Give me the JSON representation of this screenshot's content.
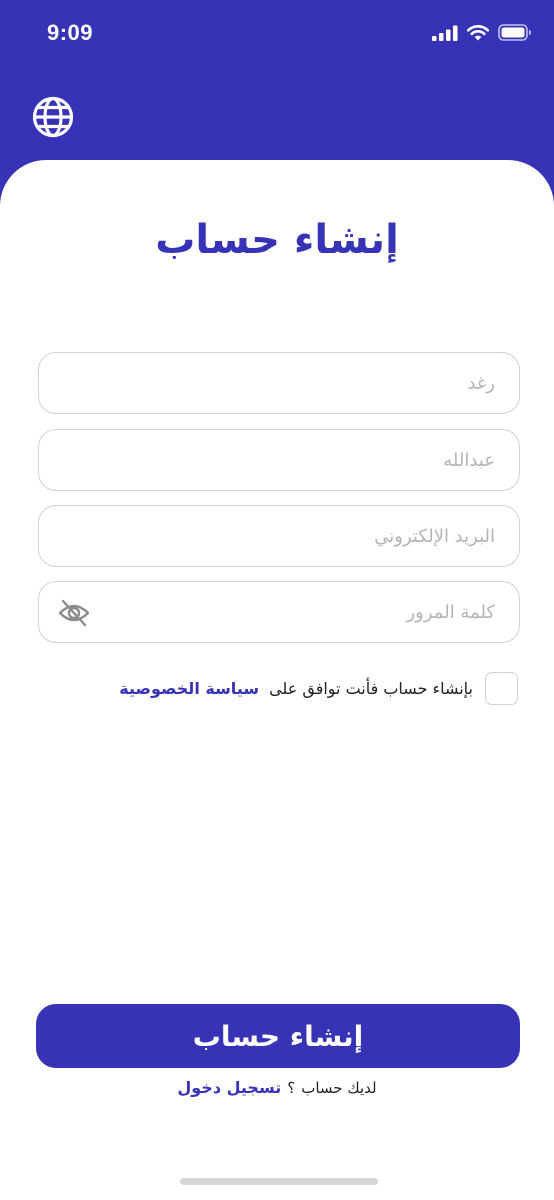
{
  "status_bar": {
    "time": "9:09"
  },
  "header": {
    "language_icon": "globe-icon"
  },
  "page": {
    "title": "إنشاء حساب"
  },
  "form": {
    "first_name_placeholder": "رغد",
    "last_name_placeholder": "عبدالله",
    "email_placeholder": "البريد الإلكتروني",
    "password_placeholder": "كلمة المرور",
    "password_toggle_icon": "eye-off-icon"
  },
  "consent": {
    "text": "بإنشاء حساب فأنت توافق على",
    "link": "سياسة الخصوصية",
    "checked": false
  },
  "actions": {
    "submit_label": "إنشاء حساب",
    "have_account": "لديك حساب",
    "question_mark": "؟",
    "signin_link": "تسجيل دخول"
  },
  "colors": {
    "primary": "#3733B6",
    "border": "#D2D2D2",
    "placeholder": "#B4B4B4"
  }
}
